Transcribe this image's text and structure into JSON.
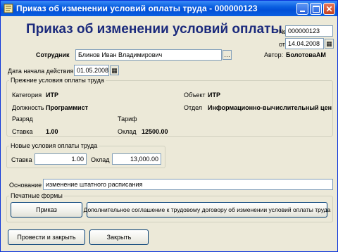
{
  "window": {
    "title": "Приказ об изменении условий оплаты труда - 000000123"
  },
  "header": {
    "title": "Приказ об изменении условий оплаты труда"
  },
  "doc": {
    "number_label": "№",
    "number": "000000123",
    "date_label": "от",
    "date": "14.04.2008"
  },
  "employee": {
    "label": "Сотрудник",
    "value": "Блинов Иван Владимирович"
  },
  "author": {
    "label": "Автор:",
    "value": "БолотоваАМ"
  },
  "start": {
    "label": "Дата начала действия",
    "value": "01.05.2008"
  },
  "previous": {
    "title": "Прежние условия оплаты труда",
    "category_label": "Категория",
    "category": "ИТР",
    "position_label": "Должность",
    "position": "Программист",
    "grade_label": "Разряд",
    "rate_label": "Ставка",
    "rate": "1.00",
    "object_label": "Объект",
    "object": "ИТР",
    "dept_label": "Отдел",
    "dept": "Информационно-вычислительный цен",
    "tariff_label": "Тариф",
    "salary_label": "Оклад",
    "salary": "12500.00"
  },
  "new": {
    "title": "Новые условия оплаты труда",
    "rate_label": "Ставка",
    "rate": "1.00",
    "salary_label": "Оклад",
    "salary": "13,000.00"
  },
  "basis": {
    "label": "Основание",
    "value": "изменение штатного расписания"
  },
  "print": {
    "title": "Печатные формы",
    "order_button": "Приказ",
    "agreement_button": "Дополнительное соглашение к трудовому договору об изменении условий оплаты труда"
  },
  "footer": {
    "post_close": "Провести и закрыть",
    "close": "Закрыть"
  },
  "icons": {
    "select": "ellipsis-icon",
    "calendar": "calendar-icon",
    "minimize": "minimize-icon",
    "maximize": "maximize-icon",
    "close": "close-icon"
  }
}
